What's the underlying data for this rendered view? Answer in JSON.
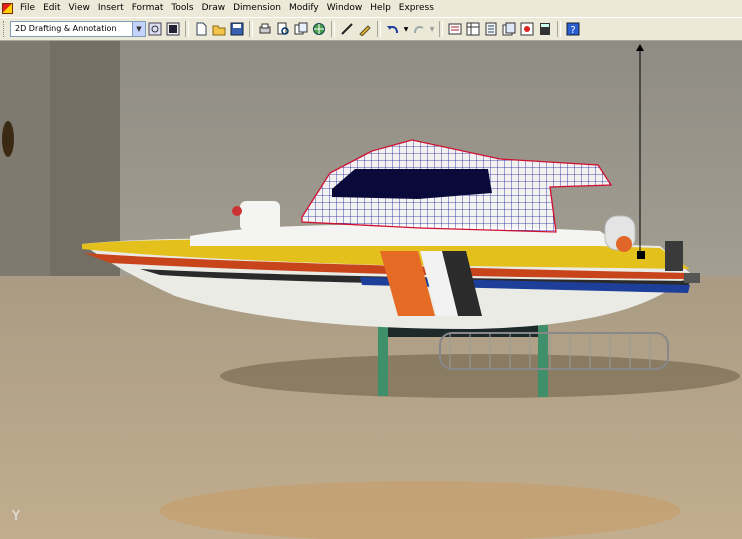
{
  "window": {
    "app_icon": "autocad-app-icon"
  },
  "menubar": {
    "items": [
      {
        "label": "File"
      },
      {
        "label": "Edit"
      },
      {
        "label": "View"
      },
      {
        "label": "Insert"
      },
      {
        "label": "Format"
      },
      {
        "label": "Tools"
      },
      {
        "label": "Draw"
      },
      {
        "label": "Dimension"
      },
      {
        "label": "Modify"
      },
      {
        "label": "Window"
      },
      {
        "label": "Help"
      },
      {
        "label": "Express"
      }
    ]
  },
  "toolbar": {
    "workspace_value": "2D Drafting & Annotation",
    "buttons": [
      "workspace-settings-icon",
      "workspace-toolbar-icon",
      "new-file-icon",
      "open-file-icon",
      "save-icon",
      "plot-icon",
      "plot-preview-icon",
      "publish-icon",
      "3d-dwf-icon",
      "cut-icon",
      "match-properties-icon",
      "undo-icon",
      "redo-icon",
      "properties-icon",
      "design-center-icon",
      "tool-palettes-icon",
      "sheet-set-icon",
      "markup-icon",
      "calculator-icon",
      "help-icon"
    ]
  },
  "canvas": {
    "ucs_label": "Y"
  },
  "colors": {
    "menubar_bg": "#ece9d8",
    "drawing_grid": "#1a1aa0",
    "drawing_outline": "#d01030"
  }
}
